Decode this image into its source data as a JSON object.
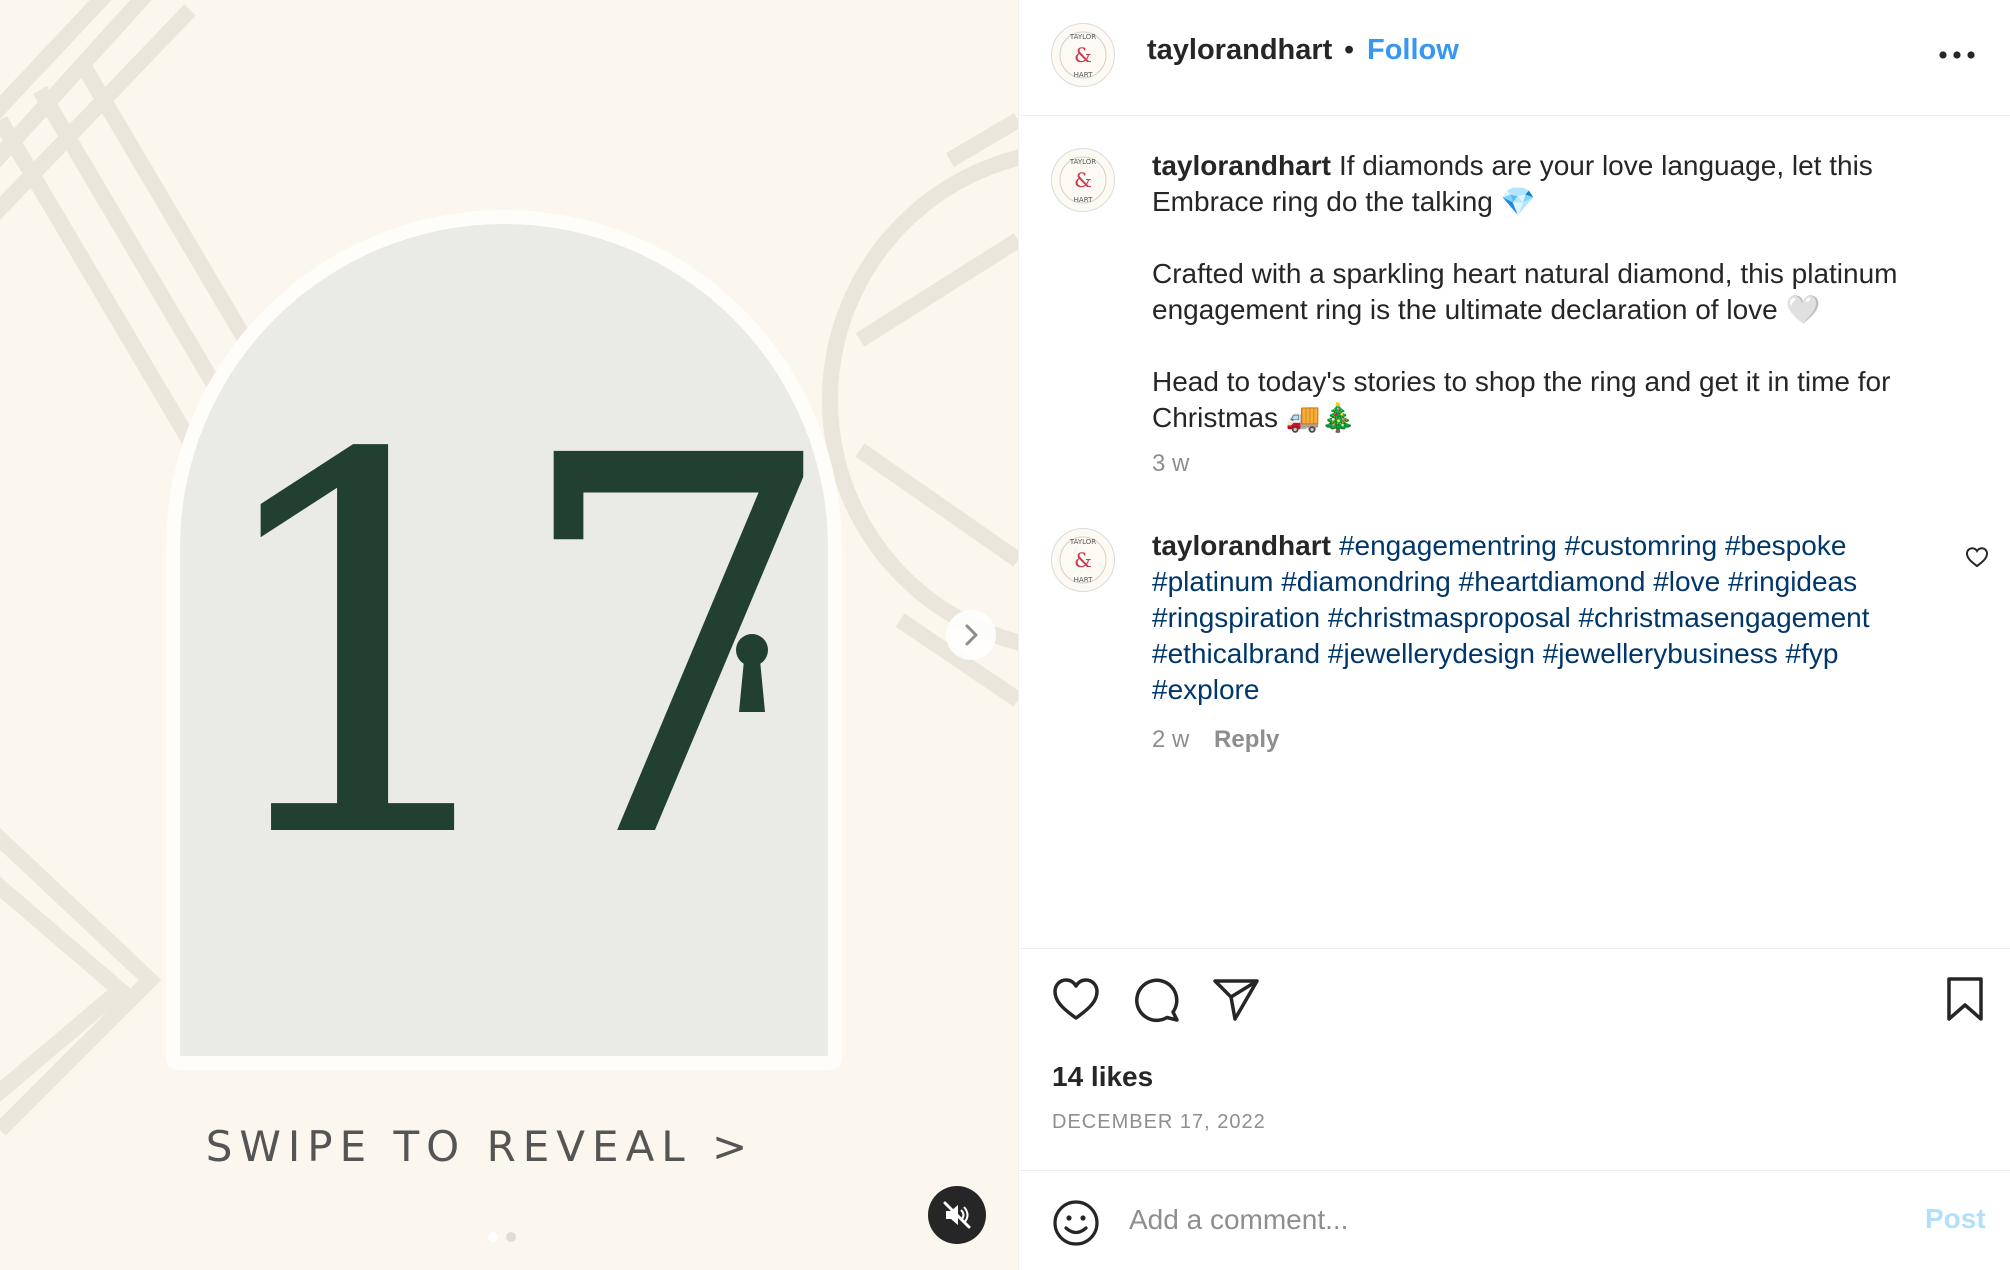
{
  "media": {
    "number": "17",
    "swipe_text": "SWIPE TO REVEAL >",
    "carousel_total": 2,
    "carousel_active": 1,
    "muted": true
  },
  "header": {
    "username": "taylorandhart",
    "separator": "•",
    "follow_label": "Follow",
    "avatar_text": "TAYLOR & HART"
  },
  "caption": {
    "username": "taylorandhart",
    "paragraphs": [
      "If diamonds are your love language, let this Embrace ring do the talking 💎",
      "Crafted with a sparkling heart natural diamond, this platinum engagement ring is the ultimate declaration of love 🤍",
      "Head to today's stories to shop the ring and get it in time for Christmas 🚚🎄"
    ],
    "time": "3 w"
  },
  "comment": {
    "username": "taylorandhart",
    "hashtags": [
      "#engagementring",
      "#customring",
      "#bespoke",
      "#platinum",
      "#diamondring",
      "#heartdiamond",
      "#love",
      "#ringideas",
      "#ringspiration",
      "#christmasproposal",
      "#christmasengagement",
      "#ethicalbrand",
      "#jewellerydesign",
      "#jewellerybusiness",
      "#fyp",
      "#explore"
    ],
    "time": "2 w",
    "reply_label": "Reply"
  },
  "actions": {
    "likes": "14 likes",
    "date": "DECEMBER 17, 2022"
  },
  "comment_bar": {
    "placeholder": "Add a comment...",
    "post_label": "Post"
  },
  "colors": {
    "accent": "#3897f0",
    "hashtag": "#00376b",
    "number": "#22402f",
    "media_bg": "#fbf7ee",
    "post_disabled": "#b2dffc"
  }
}
